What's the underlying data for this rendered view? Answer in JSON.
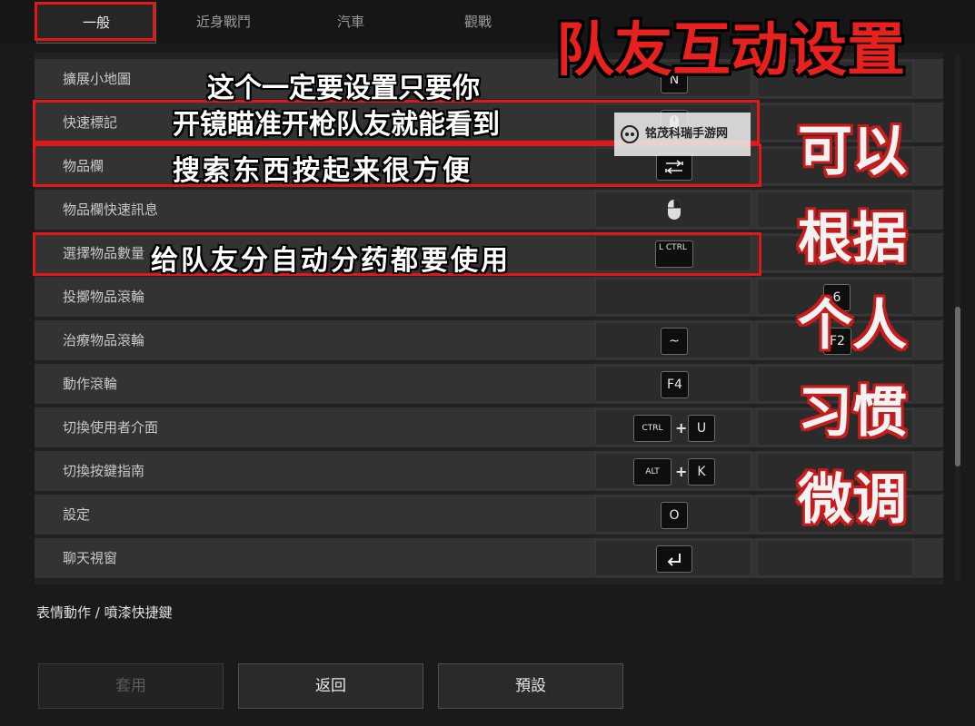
{
  "tabs": [
    {
      "label": "一般",
      "active": true
    },
    {
      "label": "近身戰鬥"
    },
    {
      "label": "汽車"
    },
    {
      "label": "觀戰"
    }
  ],
  "rows": [
    {
      "label": "擴展小地圖",
      "key1": "N"
    },
    {
      "label": "快速標記",
      "key1_icon": "mouse-middle-icon"
    },
    {
      "label": "物品欄",
      "key1_icon": "tab-key-icon"
    },
    {
      "label": "物品欄快速訊息",
      "key1_icon": "mouse-right-icon"
    },
    {
      "label": "選擇物品數量",
      "key1": "L CTRL"
    },
    {
      "label": "投擲物品滾輪",
      "key2": "6"
    },
    {
      "label": "治療物品滾輪",
      "key1": "~",
      "key2": "F2"
    },
    {
      "label": "動作滾輪",
      "key1": "F4"
    },
    {
      "label": "切換使用者介面",
      "key1": "CTRL",
      "key1_plus": "U"
    },
    {
      "label": "切換按鍵指南",
      "key1": "ALT",
      "key1_plus": "K"
    },
    {
      "label": "設定",
      "key1": "O"
    },
    {
      "label": "聊天視窗",
      "key1_icon": "enter-key-icon"
    }
  ],
  "section": {
    "title": "表情動作 / 噴漆快捷鍵"
  },
  "buttons": {
    "apply": "套用",
    "back": "返回",
    "default": "預設"
  },
  "overlay": {
    "title": "队友互动设置",
    "caption1": "这个一定要设置只要你",
    "caption2": "开镜瞄准开枪队友就能看到",
    "caption3": "搜索东西按起来很方便",
    "caption4": "给队友分自动分药都要使用",
    "side_lines": [
      "可以",
      "根据",
      "个人",
      "习惯",
      "微调"
    ],
    "watermark": "铭茂科瑞手游网"
  },
  "colors": {
    "accent_red": "#e01818",
    "panel": "#333333",
    "key_bg": "#0e0e0e"
  }
}
